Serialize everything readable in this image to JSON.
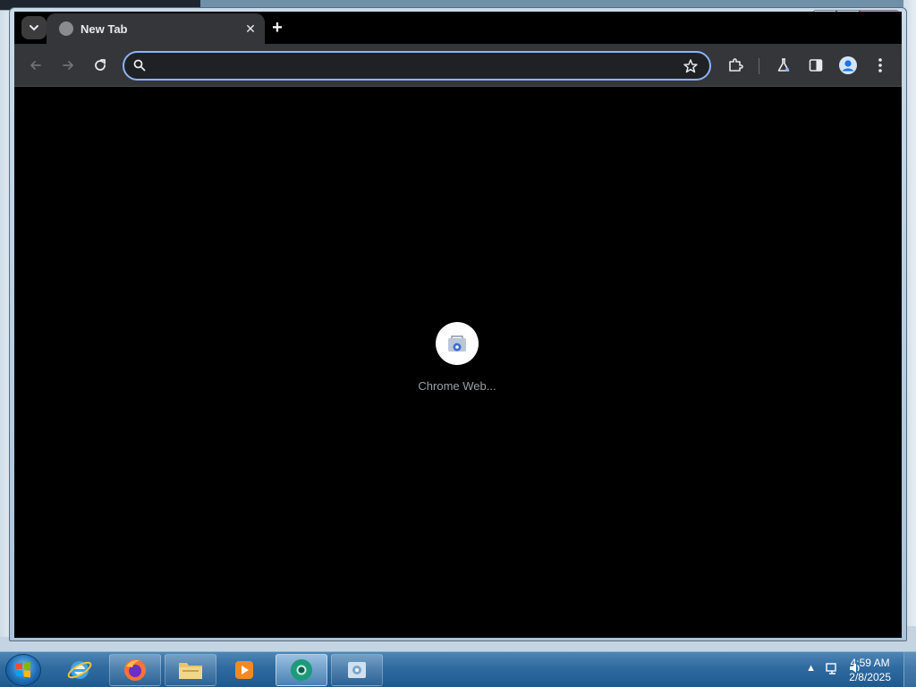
{
  "browser": {
    "tab": {
      "title": "New Tab"
    },
    "new_tab_symbol": "+",
    "omnibox": {
      "value": "",
      "placeholder": ""
    },
    "shortcuts": [
      {
        "label": "Chrome Web..."
      }
    ]
  },
  "window_controls": {
    "minimize": "–",
    "maximize": "□",
    "close": "✕"
  },
  "taskbar": {
    "apps": [
      {
        "name": "Internet Explorer"
      },
      {
        "name": "Firefox"
      },
      {
        "name": "File Explorer"
      },
      {
        "name": "Media Player"
      },
      {
        "name": "Chrome"
      },
      {
        "name": "Settings"
      }
    ],
    "tray_arrow": "▲",
    "clock": {
      "time": "4:59 AM",
      "date": "2/8/2025"
    }
  },
  "colors": {
    "accent": "#8ab4f8",
    "toolbar": "#35363a",
    "content": "#000000",
    "taskbar": "#2f6aa0"
  }
}
